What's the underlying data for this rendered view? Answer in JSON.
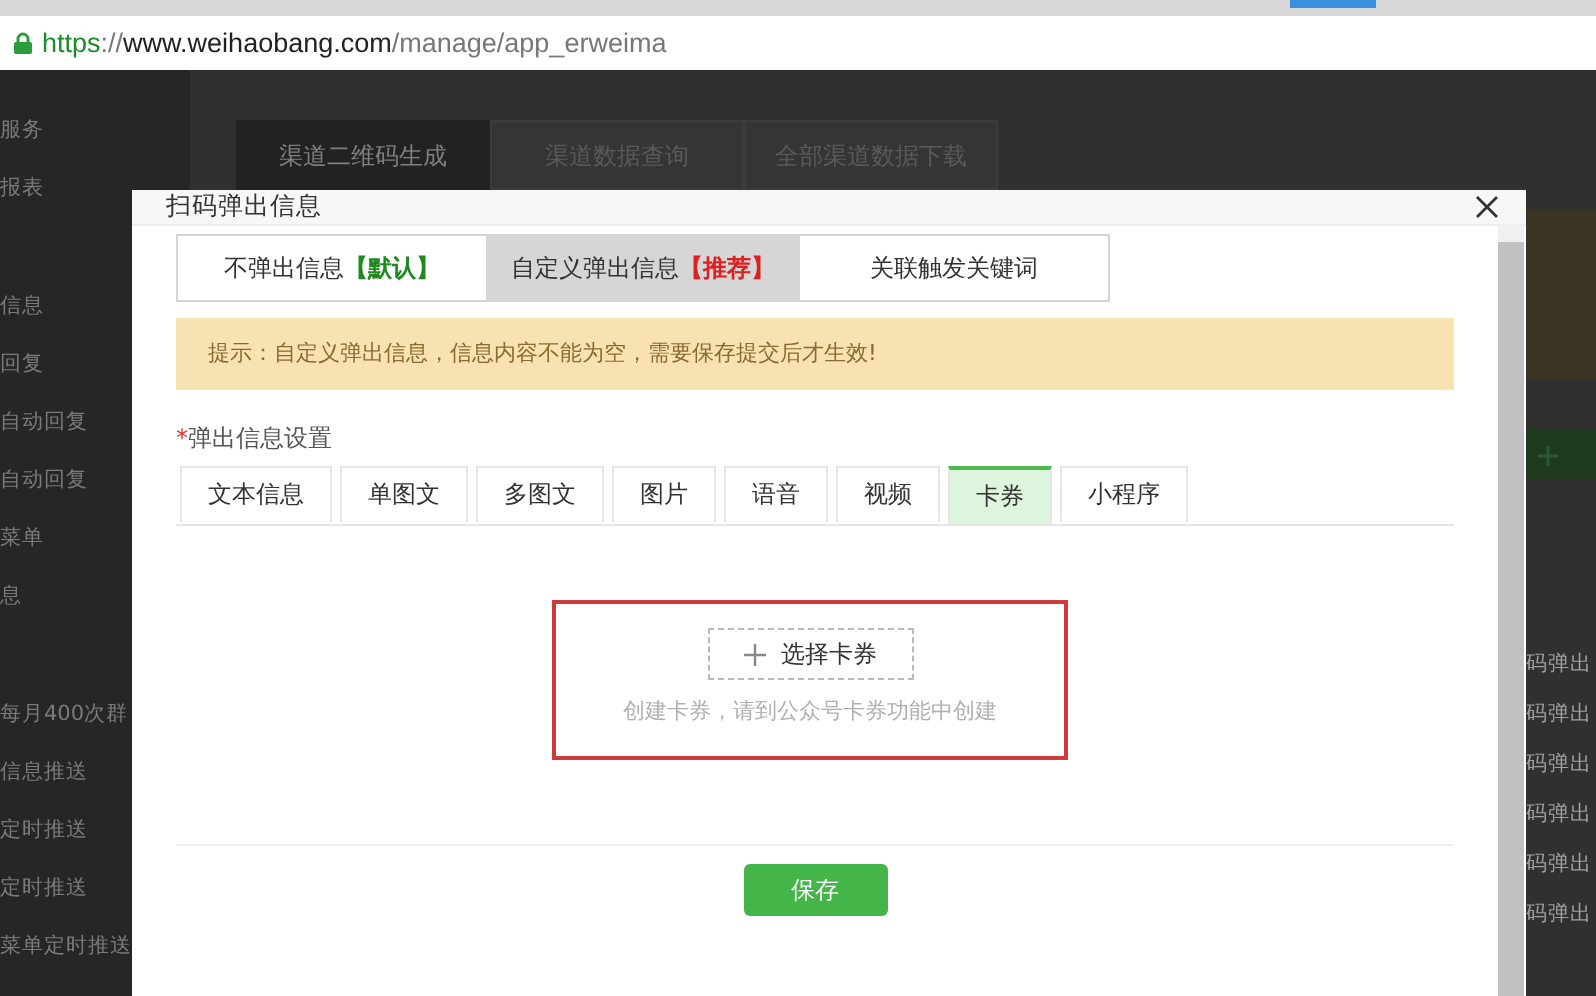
{
  "browser": {
    "url": {
      "scheme": "https",
      "separator": "://",
      "host": "www.weihaobang.com",
      "path": "/manage/app_erweima"
    }
  },
  "sidebar": {
    "groups": [
      [
        "服务",
        "报表"
      ],
      [
        "信息",
        "回复",
        "自动回复",
        "自动回复",
        "菜单",
        "息"
      ],
      [
        "每月400次群",
        "信息推送",
        "定时推送",
        "定时推送",
        "菜单定时推送"
      ]
    ]
  },
  "page_tabs": [
    {
      "label": "渠道二维码生成",
      "selected": true
    },
    {
      "label": "渠道数据查询",
      "selected": false
    },
    {
      "label": "全部渠道数据下载",
      "selected": false
    }
  ],
  "list_rows": [
    "码弹出",
    "码弹出",
    "码弹出",
    "码弹出",
    "码弹出",
    "码弹出"
  ],
  "dialog": {
    "title": "扫码弹出信息",
    "modes": [
      {
        "label": "不弹出信息",
        "tag": "【默认】",
        "color": "#1e8a1e",
        "selected": false
      },
      {
        "label": "自定义弹出信息",
        "tag": "【推荐】",
        "color": "#e02020",
        "selected": true
      },
      {
        "label": "关联触发关键词",
        "selected": false
      }
    ],
    "notice": "提示：自定义弹出信息，信息内容不能为空，需要保存提交后才生效!",
    "section_label": {
      "required_mark": "*",
      "text": "弹出信息设置"
    },
    "content_tabs": [
      {
        "label": "文本信息",
        "selected": false
      },
      {
        "label": "单图文",
        "selected": false
      },
      {
        "label": "多图文",
        "selected": false
      },
      {
        "label": "图片",
        "selected": false
      },
      {
        "label": "语音",
        "selected": false
      },
      {
        "label": "视频",
        "selected": false
      },
      {
        "label": "卡券",
        "selected": true
      },
      {
        "label": "小程序",
        "selected": false
      }
    ],
    "picker": {
      "button": "选择卡券",
      "hint": "创建卡券，请到公众号卡券功能中创建"
    },
    "save_button": "保存"
  }
}
